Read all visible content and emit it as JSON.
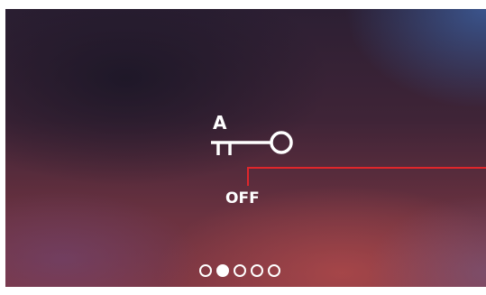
{
  "lock_control": {
    "channel_label": "A",
    "icon": "key-icon",
    "status": "OFF"
  },
  "accent_color": "#e0262b",
  "pagination": {
    "total": 5,
    "current": 2,
    "pages": [
      "page-1",
      "page-2",
      "page-3",
      "page-4",
      "page-5"
    ]
  }
}
